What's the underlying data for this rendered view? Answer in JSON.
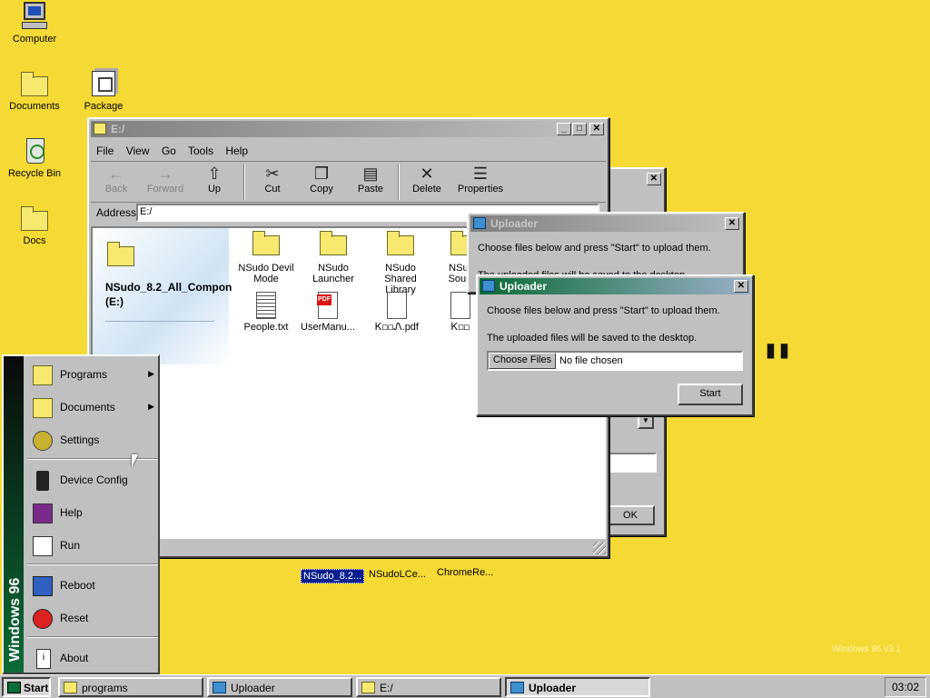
{
  "desktop": {
    "icons": [
      {
        "label": "Computer"
      },
      {
        "label": "Documents"
      },
      {
        "label": "Package"
      },
      {
        "label": "Recycle Bin"
      },
      {
        "label": "Docs"
      }
    ],
    "bottom_icons": [
      {
        "label": "NSudo_8.2..."
      },
      {
        "label": "NSudoLCe..."
      },
      {
        "label": "ChromeRe..."
      }
    ],
    "watermark": "Windows 96 v3.1"
  },
  "explorer": {
    "title": "E:/",
    "menu": [
      "File",
      "View",
      "Go",
      "Tools",
      "Help"
    ],
    "toolbar": [
      {
        "label": "Back",
        "glyph": "←",
        "disabled": true
      },
      {
        "label": "Forward",
        "glyph": "→",
        "disabled": true
      },
      {
        "label": "Up",
        "glyph": "⇧",
        "disabled": false
      },
      {
        "label": "Cut",
        "glyph": "✂",
        "disabled": false
      },
      {
        "label": "Copy",
        "glyph": "❐",
        "disabled": false
      },
      {
        "label": "Paste",
        "glyph": "📋",
        "disabled": false
      },
      {
        "label": "Delete",
        "glyph": "✕",
        "disabled": false
      },
      {
        "label": "Properties",
        "glyph": "☰",
        "disabled": false
      }
    ],
    "address_label": "Address",
    "address_value": "E:/",
    "panel_title": "NSudo_8.2_All_Compon",
    "panel_sub": "(E:)",
    "files": [
      {
        "label": "NSudo Devil Mode",
        "type": "folder"
      },
      {
        "label": "NSudo Launcher",
        "type": "folder"
      },
      {
        "label": "NSudo Shared Library",
        "type": "folder"
      },
      {
        "label": "NSudo Source",
        "type": "folder"
      },
      {
        "label": "People.txt",
        "type": "txt"
      },
      {
        "label": "UserManu...",
        "type": "pdf"
      },
      {
        "label": "Ꮶ◻◻Ꮑ.pdf",
        "type": "doc"
      },
      {
        "label": "Ꮶ◻◻",
        "type": "doc"
      }
    ]
  },
  "behind_dialog": {
    "ok_label": "OK"
  },
  "uploader_back": {
    "title": "Uploader",
    "line1": "Choose files below and press \"Start\" to upload them.",
    "line2": "The uploaded files will be saved to the desktop."
  },
  "uploader": {
    "title": "Uploader",
    "line1": "Choose files below and press \"Start\" to upload them.",
    "line2": "The uploaded files will be saved to the desktop.",
    "choose_label": "Choose Files",
    "file_status": "No file chosen",
    "start_label": "Start"
  },
  "start_menu": {
    "brand": "Windows 96",
    "items": [
      {
        "label": "Programs",
        "arrow": true
      },
      {
        "label": "Documents",
        "arrow": true
      },
      {
        "label": "Settings",
        "arrow": false
      },
      {
        "label": "Device Config",
        "arrow": false
      },
      {
        "label": "Help",
        "arrow": false
      },
      {
        "label": "Run",
        "arrow": false
      },
      {
        "label": "Reboot",
        "arrow": false
      },
      {
        "label": "Reset",
        "arrow": false
      },
      {
        "label": "About",
        "arrow": false
      }
    ]
  },
  "taskbar": {
    "start_label": "Start",
    "tasks": [
      {
        "label": "programs"
      },
      {
        "label": "Uploader"
      },
      {
        "label": "E:/"
      },
      {
        "label": "Uploader"
      }
    ],
    "clock": "03:02"
  }
}
